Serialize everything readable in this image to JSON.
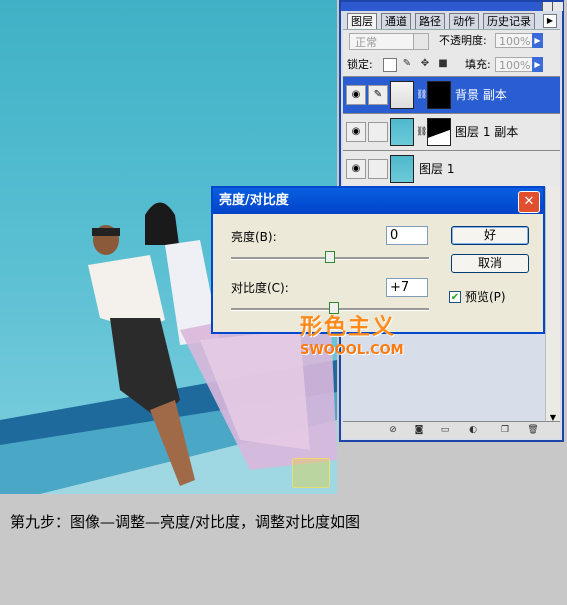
{
  "layers_panel": {
    "tabs": [
      "图层",
      "通道",
      "路径",
      "动作",
      "历史记录"
    ],
    "blend_mode": "正常",
    "opacity_label": "不透明度:",
    "opacity_value": "100%",
    "lock_label": "锁定:",
    "fill_label": "填充:",
    "fill_value": "100%",
    "layers": [
      {
        "name": "背景 副本",
        "selected": true
      },
      {
        "name": "图层 1 副本",
        "selected": false
      },
      {
        "name": "图层 1",
        "selected": false
      }
    ]
  },
  "dialog": {
    "title": "亮度/对比度",
    "brightness_label": "亮度(B):",
    "brightness_value": "0",
    "contrast_label": "对比度(C):",
    "contrast_value": "+7",
    "ok_label": "好",
    "cancel_label": "取消",
    "preview_label": "预览(P)",
    "preview_checked": true,
    "brightness_slider": 0.5,
    "contrast_slider": 0.52
  },
  "watermark": {
    "text_cn": "形色主义",
    "text_en": "SWOOOL.COM"
  },
  "caption": "第九步：图像—调整—亮度/对比度，调整对比度如图"
}
